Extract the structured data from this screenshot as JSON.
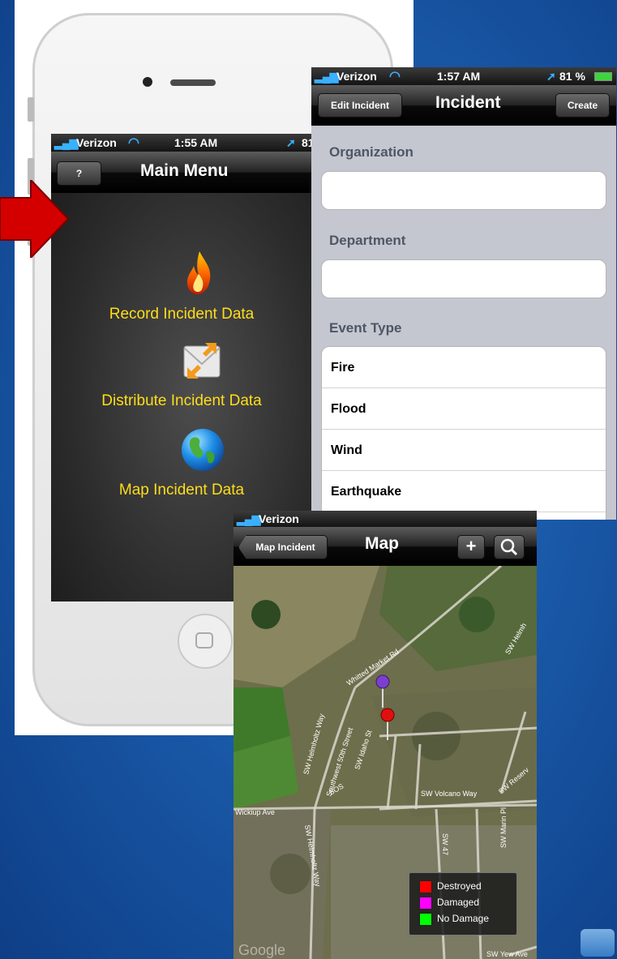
{
  "screen1": {
    "status": {
      "carrier": "Verizon",
      "time": "1:55 AM",
      "battery": "81"
    },
    "nav": {
      "help_label": "?",
      "title": "Main Menu"
    },
    "menu": [
      {
        "label": "Record Incident Data",
        "icon": "flame-icon"
      },
      {
        "label": "Distribute Incident Data",
        "icon": "envelope-arrows-icon"
      },
      {
        "label": "Map Incident Data",
        "icon": "globe-icon"
      }
    ]
  },
  "screen2": {
    "status": {
      "carrier": "Verizon",
      "time": "1:57 AM",
      "battery": "81 %"
    },
    "nav": {
      "left_label": "Edit Incident",
      "title": "Incident",
      "right_label": "Create"
    },
    "fields": {
      "organization_label": "Organization",
      "department_label": "Department",
      "event_type_label": "Event Type"
    },
    "event_types": [
      "Fire",
      "Flood",
      "Wind",
      "Earthquake"
    ]
  },
  "screen3": {
    "status": {
      "carrier": "Verizon"
    },
    "nav": {
      "back_label": "Map Incident",
      "title": "Map",
      "add_symbol": "+"
    },
    "streets": {
      "whitted": "Whitted Market Rd",
      "helmholtz_way": "SW Helmholtz Way",
      "fiftieth": "Southwest 50th Street",
      "volcano": "SW Volcano Way",
      "wickiup": "Wickiup Ave",
      "reservoir": "SW Reserv",
      "yew": "SW Yew Ave",
      "marin": "SW Marin Pl",
      "helmholtz_lower": "SW Helmholtz Way",
      "helmholtz_top": "SW Helmh",
      "forty7": "SW 47",
      "idaho": "SW Idaho St",
      "sos": "SOS"
    },
    "watermark": "Google",
    "legend": [
      {
        "label": "Destroyed",
        "color": "#ff0000"
      },
      {
        "label": "Damaged",
        "color": "#ff00ff"
      },
      {
        "label": "No Damage",
        "color": "#00ff00"
      }
    ],
    "pins": [
      {
        "color": "#7b3fd0"
      },
      {
        "color": "#e01010"
      }
    ]
  },
  "colors": {
    "menu_text": "#ffdd1a",
    "arrow": "#d40000",
    "background": "#1a5aa9"
  }
}
